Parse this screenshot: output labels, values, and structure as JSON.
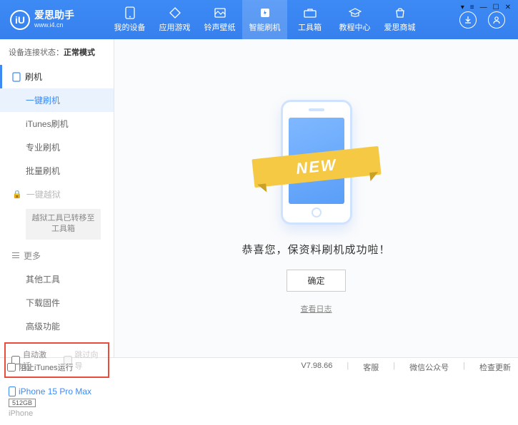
{
  "brand": {
    "title": "爱思助手",
    "subtitle": "www.i4.cn",
    "logo_letter": "iU"
  },
  "nav": [
    {
      "label": "我的设备"
    },
    {
      "label": "应用游戏"
    },
    {
      "label": "铃声壁纸"
    },
    {
      "label": "智能刷机"
    },
    {
      "label": "工具箱"
    },
    {
      "label": "教程中心"
    },
    {
      "label": "爱思商城"
    }
  ],
  "conn": {
    "prefix": "设备连接状态：",
    "status": "正常模式"
  },
  "side": {
    "flash_hdr": "刷机",
    "items_flash": [
      "一键刷机",
      "iTunes刷机",
      "专业刷机",
      "批量刷机"
    ],
    "jailbreak_hdr": "一键越狱",
    "jailbreak_note": "越狱工具已转移至\n工具箱",
    "more_hdr": "更多",
    "items_more": [
      "其他工具",
      "下载固件",
      "高级功能"
    ]
  },
  "opts": {
    "auto_activate": "自动激活",
    "skip_setup": "跳过向导"
  },
  "device": {
    "name": "iPhone 15 Pro Max",
    "storage": "512GB",
    "type": "iPhone"
  },
  "main": {
    "ribbon": "NEW",
    "success": "恭喜您，保资料刷机成功啦！",
    "ok": "确定",
    "view_log": "查看日志"
  },
  "footer": {
    "block_itunes": "阻止iTunes运行",
    "version": "V7.98.66",
    "links": [
      "客服",
      "微信公众号",
      "检查更新"
    ]
  }
}
